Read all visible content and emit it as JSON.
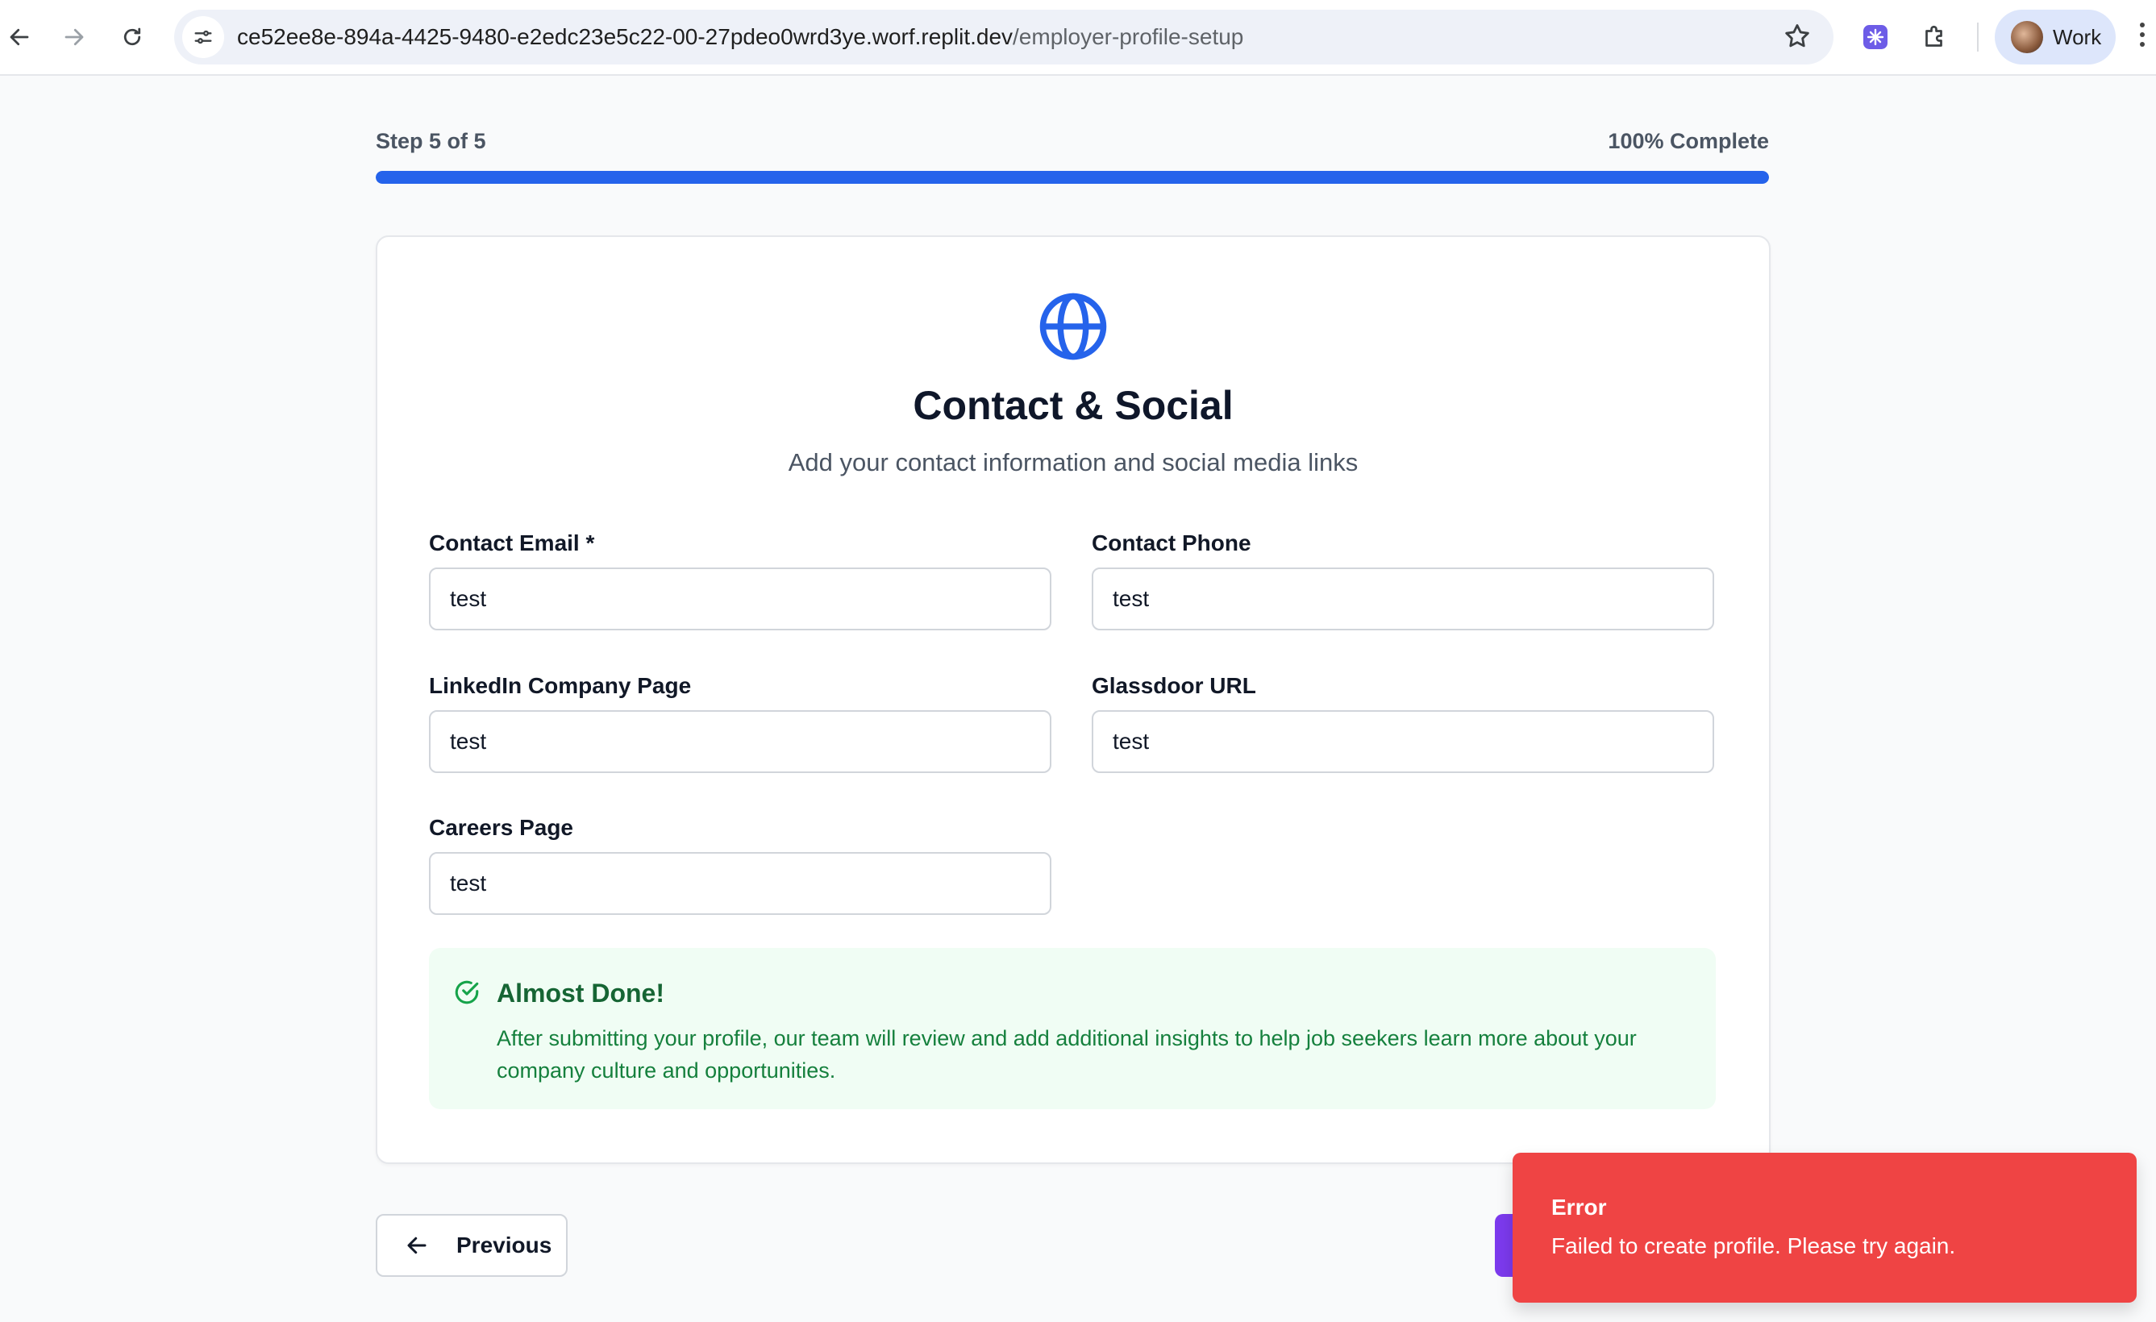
{
  "browser": {
    "url_host": "ce52ee8e-894a-4425-9480-e2edc23e5c22-00-27pdeo0wrd3ye.worf.replit.dev",
    "url_path": "/employer-profile-setup",
    "profile_label": "Work"
  },
  "progress": {
    "step_label": "Step 5 of 5",
    "percent_label": "100% Complete",
    "percent": 100
  },
  "card": {
    "title": "Contact & Social",
    "subtitle": "Add your contact information and social media links"
  },
  "fields": {
    "contact_email": {
      "label": "Contact Email *",
      "value": "test"
    },
    "contact_phone": {
      "label": "Contact Phone",
      "value": "test"
    },
    "linkedin": {
      "label": "LinkedIn Company Page",
      "value": "test"
    },
    "glassdoor": {
      "label": "Glassdoor URL",
      "value": "test"
    },
    "careers": {
      "label": "Careers Page",
      "value": "test"
    }
  },
  "notice": {
    "title": "Almost Done!",
    "body": "After submitting your profile, our team will review and add additional insights to help job seekers learn more about your company culture and opportunities."
  },
  "buttons": {
    "previous": "Previous"
  },
  "toast": {
    "title": "Error",
    "message": "Failed to create profile. Please try again."
  },
  "colors": {
    "accent": "#2563eb",
    "success_bg": "#f0fdf4",
    "success_text": "#166534",
    "error": "#ef4444",
    "submit": "#7c3aed"
  }
}
